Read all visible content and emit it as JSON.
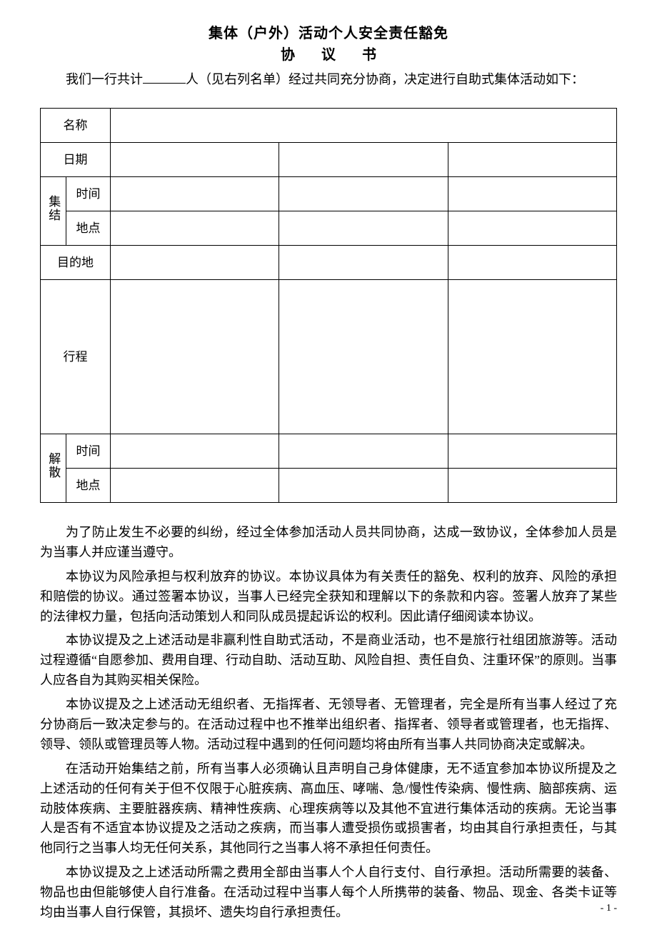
{
  "title": {
    "line1": "集体（户外）活动个人安全责任豁免",
    "line2": "协  议  书"
  },
  "intro": {
    "prefix": "我们一行共计",
    "suffix": "人（见右列名单）经过共同充分协商，决定进行自助式集体活动如下："
  },
  "table": {
    "labels": {
      "name": "名称",
      "date": "日期",
      "assemble": "集结",
      "time": "时间",
      "place": "地点",
      "destination": "目的地",
      "itinerary": "行程",
      "disband": "解散"
    },
    "values": {
      "name": "",
      "date_c1": "",
      "date_c2": "",
      "date_c3": "",
      "assemble_time_c1": "",
      "assemble_time_c2": "",
      "assemble_time_c3": "",
      "assemble_place_c1": "",
      "assemble_place_c2": "",
      "assemble_place_c3": "",
      "destination_c1": "",
      "destination_c2": "",
      "destination_c3": "",
      "itinerary_c1": "",
      "itinerary_c2": "",
      "itinerary_c3": "",
      "disband_time_c1": "",
      "disband_time_c2": "",
      "disband_time_c3": "",
      "disband_place_c1": "",
      "disband_place_c2": "",
      "disband_place_c3": ""
    }
  },
  "paragraphs": {
    "p1": "为了防止发生不必要的纠纷，经过全体参加活动人员共同协商，达成一致协议，全体参加人员是为当事人并应谨当遵守。",
    "p2": "本协议为风险承担与权利放弃的协议。本协议具体为有关责任的豁免、权利的放弃、风险的承担和赔偿的协议。通过签署本协议，当事人已经完全获知和理解以下的条款和内容。签署人放弃了某些的法律权力量，包括向活动策划人和同队成员提起诉讼的权利。因此请仔细阅读本协议。",
    "p3": "本协议提及之上述活动是非赢利性自助式活动，不是商业活动，也不是旅行社组团旅游等。活动过程遵循“自愿参加、费用自理、行动自助、活动互助、风险自担、责任自负、注重环保”的原则。当事人应各自为其购买相关保险。",
    "p4": "本协议提及之上述活动无组织者、无指挥者、无领导者、无管理者，完全是所有当事人经过了充分协商后一致决定参与的。在活动过程中也不推举出组织者、指挥者、领导者或管理者，也无指挥、领导、领队或管理员等人物。活动过程中遇到的任何问题均将由所有当事人共同协商决定或解决。",
    "p5": "在活动开始集结之前，所有当事人必须确认且声明自己身体健康，无不适宜参加本协议所提及之上述活动的任何有关于但不仅限于心脏疾病、高血压、哮喘、急/慢性传染病、慢性病、脑部疾病、运动肢体疾病、主要脏器疾病、精神性疾病、心理疾病等以及其他不宜进行集体活动的疾病。无论当事人是否有不适宜本协议提及之活动之疾病，而当事人遭受损伤或损害者，均由其自行承担责任，与其他同行之当事人均无任何关系，其他同行之当事人将不承担任何责任。",
    "p6": "本协议提及之上述活动所需之费用全部由当事人个人自行支付、自行承担。活动所需要的装备、物品也由但能够使人自行准备。在活动过程中当事人每个人所携带的装备、物品、现金、各类卡证等均由当事人自行保管，其损坏、遗失均自行承担责任。"
  },
  "footer": {
    "page": "- 1 -"
  }
}
